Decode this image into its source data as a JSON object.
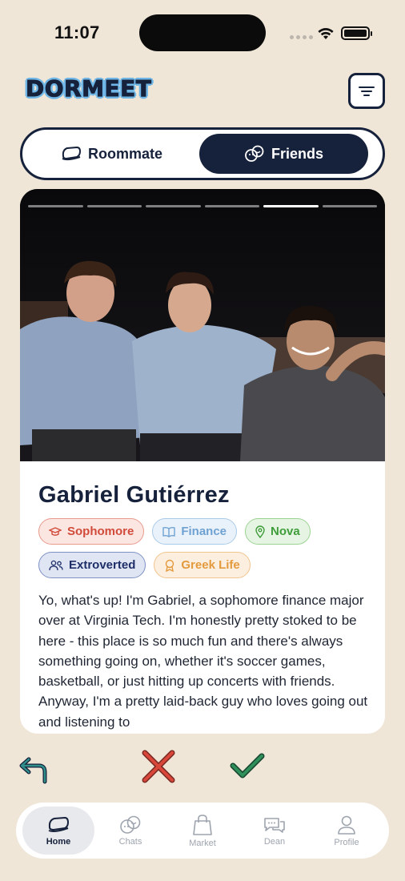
{
  "status_bar": {
    "time": "11:07"
  },
  "header": {
    "logo": "DORMEET",
    "menu_icon": "filter-menu-icon"
  },
  "mode_toggle": {
    "selected": "Friends",
    "tabs": [
      {
        "label": "Roommate",
        "icon": "pillow-icon"
      },
      {
        "label": "Friends",
        "icon": "friends-icon"
      }
    ]
  },
  "profile": {
    "photo_count": 6,
    "active_photo_index": 5,
    "name": "Gabriel Gutiérrez",
    "tags": [
      {
        "label": "Sophomore",
        "icon": "graduation-cap-icon",
        "color": "#d24b3a"
      },
      {
        "label": "Finance",
        "icon": "book-icon",
        "color": "#6fa2d2"
      },
      {
        "label": "Nova",
        "icon": "location-pin-icon",
        "color": "#3f9d3a"
      },
      {
        "label": "Extroverted",
        "icon": "people-icon",
        "color": "#1d2e68"
      },
      {
        "label": "Greek Life",
        "icon": "award-icon",
        "color": "#e39a3c"
      }
    ],
    "bio": "Yo, what's up! I'm Gabriel, a sophomore finance major over at Virginia Tech. I'm honestly pretty stoked to be here - this place is so much fun and there's always something going on, whether it's soccer games, basketball, or just hitting up concerts with friends. Anyway, I'm a pretty laid-back guy who loves going out and listening to"
  },
  "actions": {
    "undo_icon": "undo-arrow-icon",
    "reject_icon": "x-icon",
    "like_icon": "checkmark-icon"
  },
  "tab_bar": {
    "items": [
      {
        "label": "Home",
        "icon": "pillow-icon",
        "active": true
      },
      {
        "label": "Chats",
        "icon": "chat-bubbles-icon",
        "active": false
      },
      {
        "label": "Market",
        "icon": "shopping-bag-icon",
        "active": false
      },
      {
        "label": "Dean",
        "icon": "dean-chat-icon",
        "active": false
      },
      {
        "label": "Profile",
        "icon": "user-icon",
        "active": false
      }
    ]
  },
  "colors": {
    "background": "#efe6d8",
    "navy": "#16213b",
    "accent_blue": "#6fb6e6",
    "reject_red": "#d9473a",
    "like_green": "#2f8f5a",
    "undo_teal": "#2f8f8a"
  }
}
